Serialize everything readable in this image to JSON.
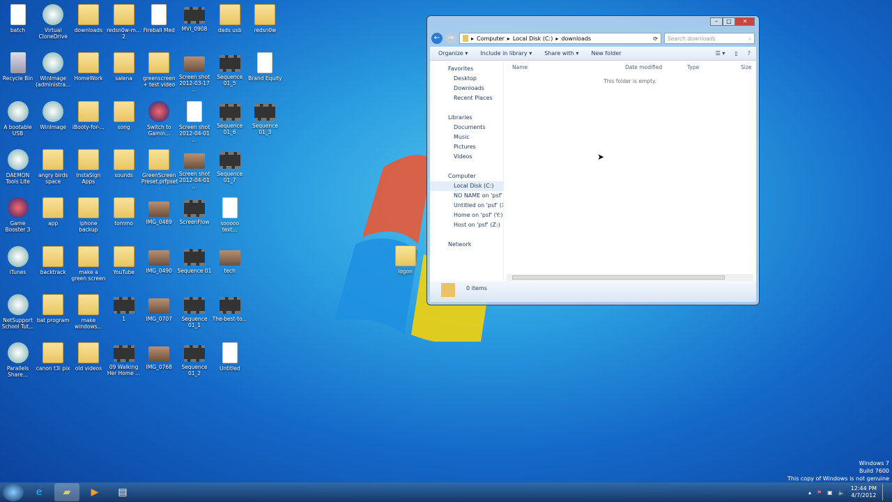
{
  "desktop": {
    "rows": [
      [
        {
          "label": "batch",
          "type": "file"
        },
        {
          "label": "Virtual CloneDrive",
          "type": "app"
        },
        {
          "label": "downloads",
          "type": "folder"
        },
        {
          "label": "redsn0w-m... 2",
          "type": "folder"
        },
        {
          "label": "Fireball Med",
          "type": "audio"
        },
        {
          "label": "MVI_0908",
          "type": "video"
        },
        {
          "label": "dads usb",
          "type": "folder"
        },
        {
          "label": "redsn0w",
          "type": "folder"
        }
      ],
      [
        {
          "label": "Recycle Bin",
          "type": "bin"
        },
        {
          "label": "WinImage (administra...",
          "type": "app"
        },
        {
          "label": "HomeWork",
          "type": "folder"
        },
        {
          "label": "salena",
          "type": "folder"
        },
        {
          "label": "greenscreen + test video",
          "type": "folder"
        },
        {
          "label": "Screen shot 2012-03-17 ...",
          "type": "photo"
        },
        {
          "label": "Sequence 01_5",
          "type": "video"
        },
        {
          "label": "Brand Equity",
          "type": "audio"
        }
      ],
      [
        {
          "label": "A bootable USB",
          "type": "app"
        },
        {
          "label": "WinImage",
          "type": "app"
        },
        {
          "label": "iBooty-for-...",
          "type": "folder"
        },
        {
          "label": "song",
          "type": "folder"
        },
        {
          "label": "Switch to Gamin...",
          "type": "shortcut"
        },
        {
          "label": "Screen shot 2012-04-01 ...",
          "type": "file"
        },
        {
          "label": "Sequence 01_6",
          "type": "video"
        },
        {
          "label": "Sequence 01_3",
          "type": "video"
        }
      ],
      [
        {
          "label": "DAEMON Tools Lite",
          "type": "app"
        },
        {
          "label": "angry birds space",
          "type": "folder"
        },
        {
          "label": "InstaSign Apps",
          "type": "folder"
        },
        {
          "label": "sounds",
          "type": "folder"
        },
        {
          "label": "GreenScreen Preset.prfpset",
          "type": "folder"
        },
        {
          "label": "Screen shot 2012-04-01 ...",
          "type": "photo"
        },
        {
          "label": "Sequence 01_7",
          "type": "video"
        }
      ],
      [
        {
          "label": "Game Booster 3",
          "type": "shortcut"
        },
        {
          "label": "app",
          "type": "folder"
        },
        {
          "label": "iphone backup",
          "type": "folder"
        },
        {
          "label": "tommo",
          "type": "folder"
        },
        {
          "label": "IMG_0489",
          "type": "photo"
        },
        {
          "label": "ScreenFlow",
          "type": "video"
        },
        {
          "label": "sooooo text...",
          "type": "file"
        }
      ],
      [
        {
          "label": "iTunes",
          "type": "app"
        },
        {
          "label": "backtrack",
          "type": "folder"
        },
        {
          "label": "make a green screen",
          "type": "folder"
        },
        {
          "label": "YouTube",
          "type": "folder"
        },
        {
          "label": "IMG_0490",
          "type": "photo"
        },
        {
          "label": "Sequence 01",
          "type": "video"
        },
        {
          "label": "tech",
          "type": "photo"
        }
      ],
      [
        {
          "label": "NetSupport School Tut...",
          "type": "app"
        },
        {
          "label": "bat program",
          "type": "folder"
        },
        {
          "label": "make windows...",
          "type": "folder"
        },
        {
          "label": "1",
          "type": "video"
        },
        {
          "label": "IMG_0707",
          "type": "photo"
        },
        {
          "label": "Sequence 01_1",
          "type": "video"
        },
        {
          "label": "The-best-to...",
          "type": "video"
        }
      ],
      [
        {
          "label": "Parallels Share...",
          "type": "app"
        },
        {
          "label": "canon t3i pix",
          "type": "folder"
        },
        {
          "label": "old videos",
          "type": "folder"
        },
        {
          "label": "09 Walking Her Home ...",
          "type": "video"
        },
        {
          "label": "IMG_0768",
          "type": "photo"
        },
        {
          "label": "Sequence 01_2",
          "type": "video"
        },
        {
          "label": "Untitled",
          "type": "audio"
        }
      ]
    ],
    "extra": {
      "label": "logon",
      "type": "folder"
    }
  },
  "explorer": {
    "breadcrumb": [
      "Computer",
      "Local Disk (C:)",
      "downloads"
    ],
    "search_placeholder": "Search downloads",
    "toolbar": {
      "organize": "Organize ▾",
      "include": "Include in library ▾",
      "share": "Share with ▾",
      "new_folder": "New folder"
    },
    "nav": {
      "favorites": "Favorites",
      "fav_items": [
        "Desktop",
        "Downloads",
        "Recent Places"
      ],
      "libraries": "Libraries",
      "lib_items": [
        "Documents",
        "Music",
        "Pictures",
        "Videos"
      ],
      "computer": "Computer",
      "comp_items": [
        "Local Disk (C:)",
        "NO NAME on 'psf' (",
        "Untitled on 'psf' (X:)",
        "Home on 'psf' (Y:)",
        "Host on 'psf' (Z:)"
      ],
      "network": "Network"
    },
    "columns": [
      "Name",
      "Date modified",
      "Type",
      "Size"
    ],
    "empty_text": "This folder is empty.",
    "status": "0 items"
  },
  "watermark": [
    "Windows 7",
    "Build 7600",
    "This copy of Windows is not genuine"
  ],
  "clock": {
    "time": "12:44 PM",
    "date": "4/7/2012"
  }
}
